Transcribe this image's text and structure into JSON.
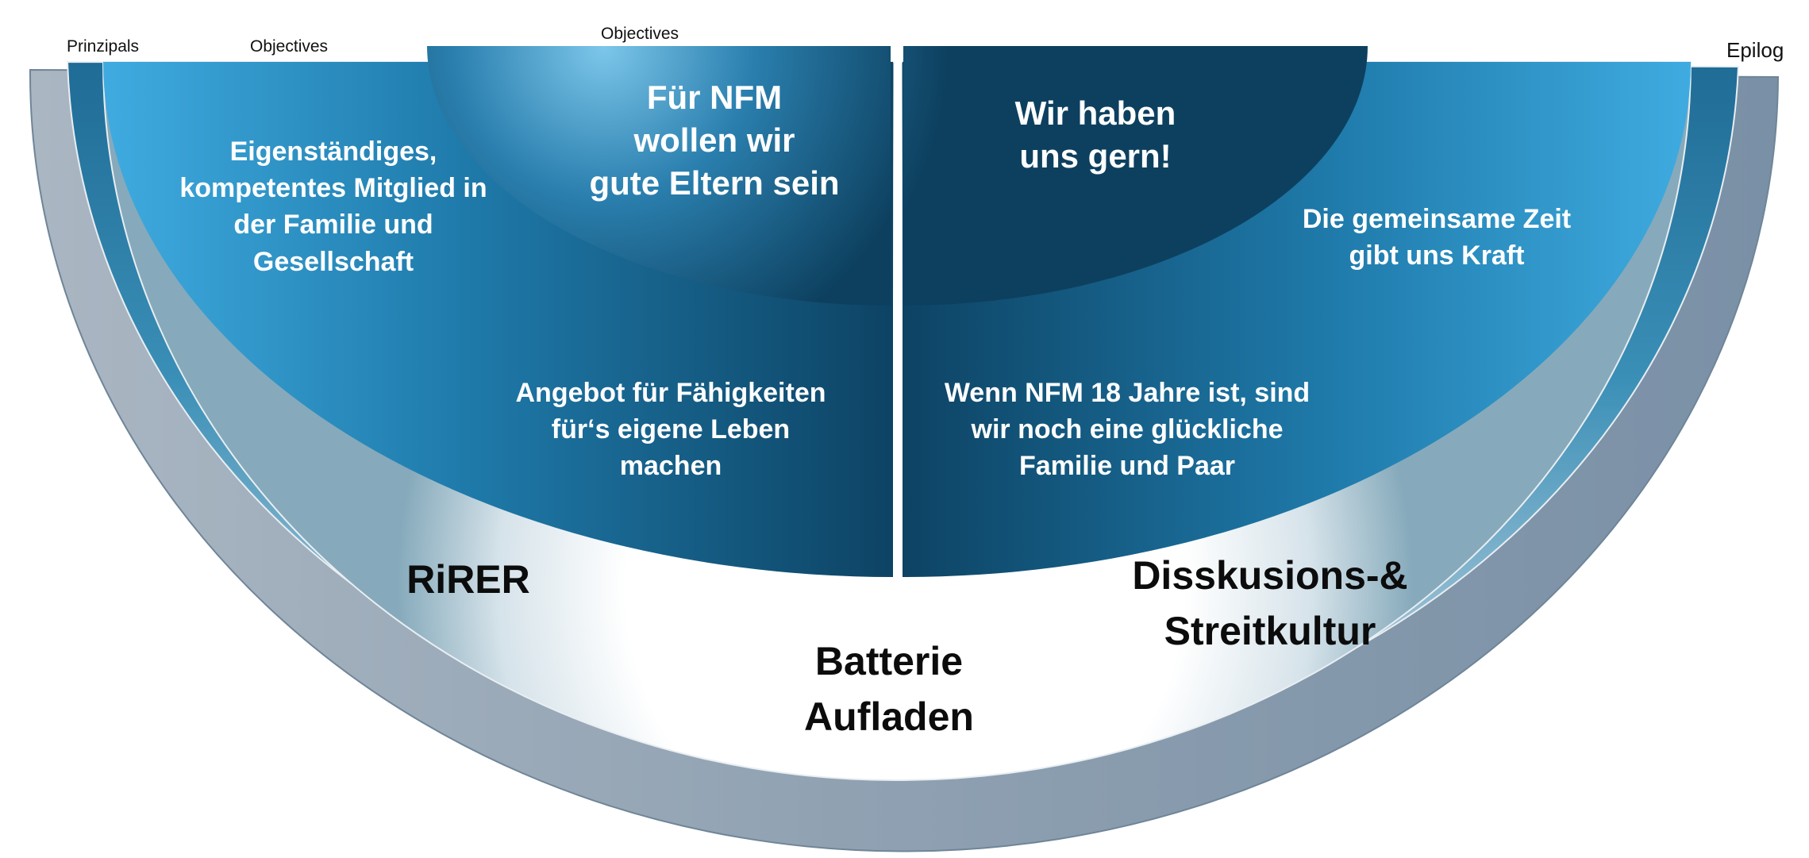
{
  "header_labels": {
    "prinzipals": "Prinzipals",
    "objectives_left": "Objectives",
    "objectives_center": "Objectives",
    "epilog": "Epilog"
  },
  "segments": {
    "upper_left": [
      "Für NFM",
      "wollen wir",
      "gute Eltern sein"
    ],
    "upper_right": [
      "Wir haben",
      "uns gern!"
    ],
    "left_outer": [
      "Eigenständiges,",
      "kompetentes Mitglied in",
      "der Familie und",
      "Gesellschaft"
    ],
    "left_inner": [
      "Angebot für Fähigkeiten",
      "für‘s eigene Leben",
      "machen"
    ],
    "right_outer": [
      "Die gemeinsame Zeit",
      "gibt uns Kraft"
    ],
    "right_inner": [
      "Wenn NFM 18 Jahre ist, sind",
      "wir noch eine glückliche",
      "Familie und Paar"
    ]
  },
  "foundation": {
    "left": "RiRER",
    "center": [
      "Batterie",
      "Aufladen"
    ],
    "right": [
      "Disskusions-&",
      "Streitkultur"
    ]
  },
  "colors": {
    "outer_ring": "#94a6b7",
    "middle_ring": "#2a7aa6",
    "inner_blue_light": "#3aa7db",
    "inner_blue_dark": "#0e4566",
    "white_core": "#ffffff"
  }
}
